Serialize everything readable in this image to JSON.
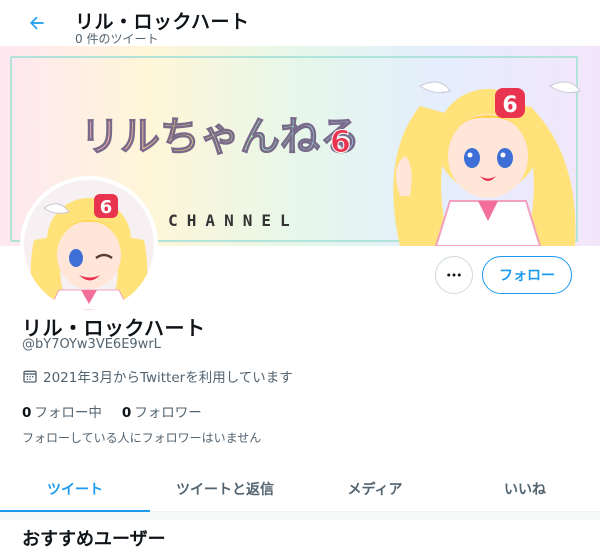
{
  "header": {
    "name": "リル・ロックハート",
    "tweet_count": "0 件のツイート",
    "back_icon": "arrow-left-icon"
  },
  "banner": {
    "title": "リルちゃんねる",
    "title_number": "6",
    "subtitle": "LILL CHANNEL",
    "badge": "6"
  },
  "profile": {
    "name": "リル・ロックハート",
    "handle": "@bY7OYw3VE6E9wrL",
    "joined": "2021年3月からTwitterを利用しています",
    "following_count": "0",
    "following_label": "フォロー中",
    "followers_count": "0",
    "followers_label": "フォロワー",
    "followed_note": "フォローしている人にフォロワーはいません"
  },
  "actions": {
    "more_icon": "more-horizontal-icon",
    "follow_label": "フォロー"
  },
  "tabs": [
    {
      "label": "ツイート",
      "active": true
    },
    {
      "label": "ツイートと返信",
      "active": false
    },
    {
      "label": "メディア",
      "active": false
    },
    {
      "label": "いいね",
      "active": false
    }
  ],
  "recommendations": {
    "title": "おすすめユーザー"
  },
  "colors": {
    "accent": "#1d9bf0",
    "text": "#0f1419",
    "secondary": "#536471"
  }
}
